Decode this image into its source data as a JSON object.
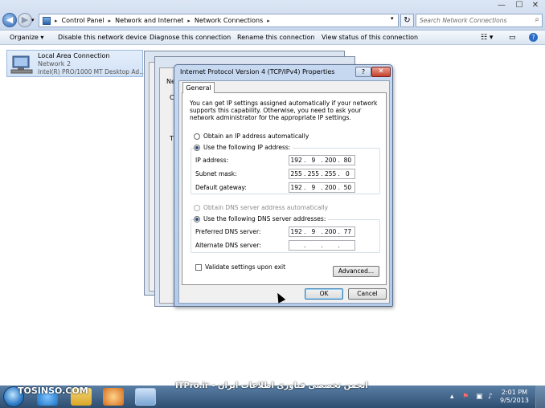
{
  "address_bar": {
    "crumbs": [
      "Control Panel",
      "Network and Internet",
      "Network Connections"
    ],
    "search_placeholder": "Search Network Connections"
  },
  "command_bar": {
    "organize": "Organize ▾",
    "disable": "Disable this network device",
    "diagnose": "Diagnose this connection",
    "rename": "Rename this connection",
    "view_status": "View status of this connection"
  },
  "connection": {
    "name": "Local Area Connection",
    "network": "Network  2",
    "device": "Intel(R) PRO/1000 MT Desktop Ad..."
  },
  "background_windows": {
    "fragment_a": "L",
    "fragment_b": "Ne",
    "fragment_c": "C",
    "fragment_d": "T"
  },
  "dialog": {
    "title": "Internet Protocol Version 4 (TCP/IPv4) Properties",
    "help": "?",
    "close": "✕",
    "tab": "General",
    "intro": "You can get IP settings assigned automatically if your network supports this capability. Otherwise, you need to ask your network administrator for the appropriate IP settings.",
    "obtain_ip_auto": "Obtain an IP address automatically",
    "use_following_ip": "Use the following IP address:",
    "ip_label": "IP address:",
    "ip": [
      "192",
      "9",
      "200",
      "80"
    ],
    "subnet_label": "Subnet mask:",
    "subnet": [
      "255",
      "255",
      "255",
      "0"
    ],
    "gateway_label": "Default gateway:",
    "gateway": [
      "192",
      "9",
      "200",
      "50"
    ],
    "obtain_dns_auto": "Obtain DNS server address automatically",
    "use_following_dns": "Use the following DNS server addresses:",
    "preferred_dns_label": "Preferred DNS server:",
    "preferred_dns": [
      "192",
      "9",
      "200",
      "77"
    ],
    "alternate_dns_label": "Alternate DNS server:",
    "alternate_dns": [
      "",
      "",
      "",
      ""
    ],
    "validate": "Validate settings upon exit",
    "advanced": "Advanced...",
    "ok": "OK",
    "cancel": "Cancel"
  },
  "taskbar": {
    "time": "2:01 PM",
    "date": "9/5/2013"
  },
  "watermarks": {
    "left": "TOSINSO.COM",
    "right": "ITPro.ir - انجمن تخصصی فناوری اطلاعات ایران"
  }
}
